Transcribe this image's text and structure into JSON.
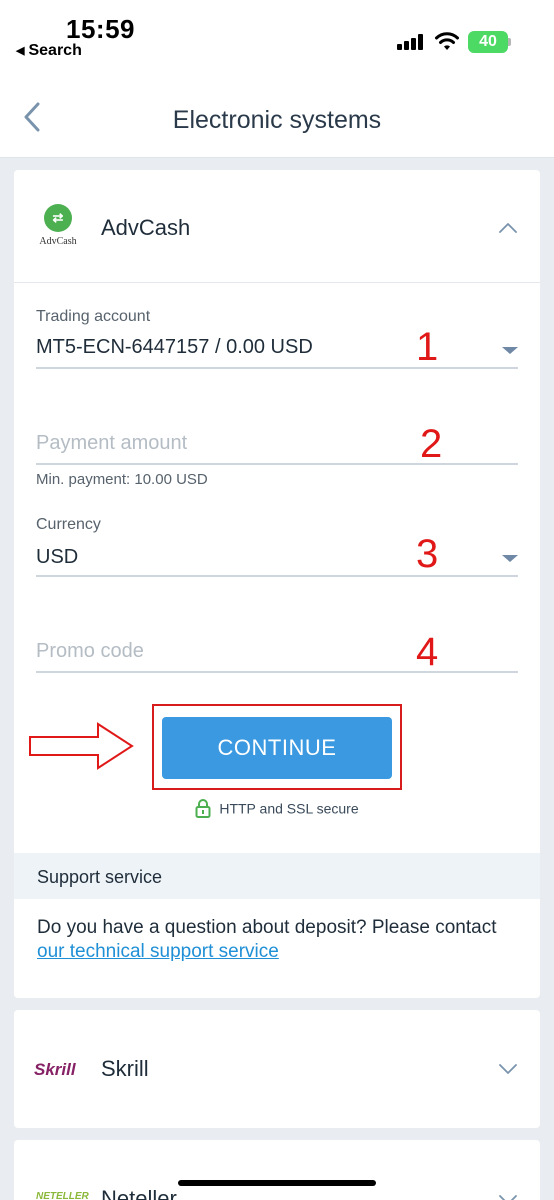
{
  "status_bar": {
    "time": "15:59",
    "back_app": "Search",
    "battery": "40"
  },
  "header": {
    "title": "Electronic systems"
  },
  "advcash": {
    "logo_text": "AdvCash",
    "name": "AdvCash",
    "expanded": true
  },
  "form": {
    "trading_account": {
      "label": "Trading account",
      "value": "MT5-ECN-6447157 / 0.00 USD"
    },
    "payment_amount": {
      "placeholder": "Payment amount",
      "hint": "Min. payment: 10.00 USD"
    },
    "currency": {
      "label": "Currency",
      "value": "USD"
    },
    "promo_code": {
      "placeholder": "Promo code"
    },
    "continue_label": "CONTINUE",
    "secure_text": "HTTP and SSL secure"
  },
  "annotations": [
    "1",
    "2",
    "3",
    "4"
  ],
  "support": {
    "title": "Support service",
    "text": "Do you have a question about deposit? Please contact",
    "link": "our technical support service"
  },
  "other_methods": [
    {
      "logo_text": "Skrill",
      "name": "Skrill"
    },
    {
      "logo_text": "NETELLER",
      "name": "Neteller"
    }
  ],
  "colors": {
    "accent": "#3a99e0",
    "annotation_red": "#e01818",
    "link": "#1f8fd6",
    "secure_green": "#4caf50"
  }
}
